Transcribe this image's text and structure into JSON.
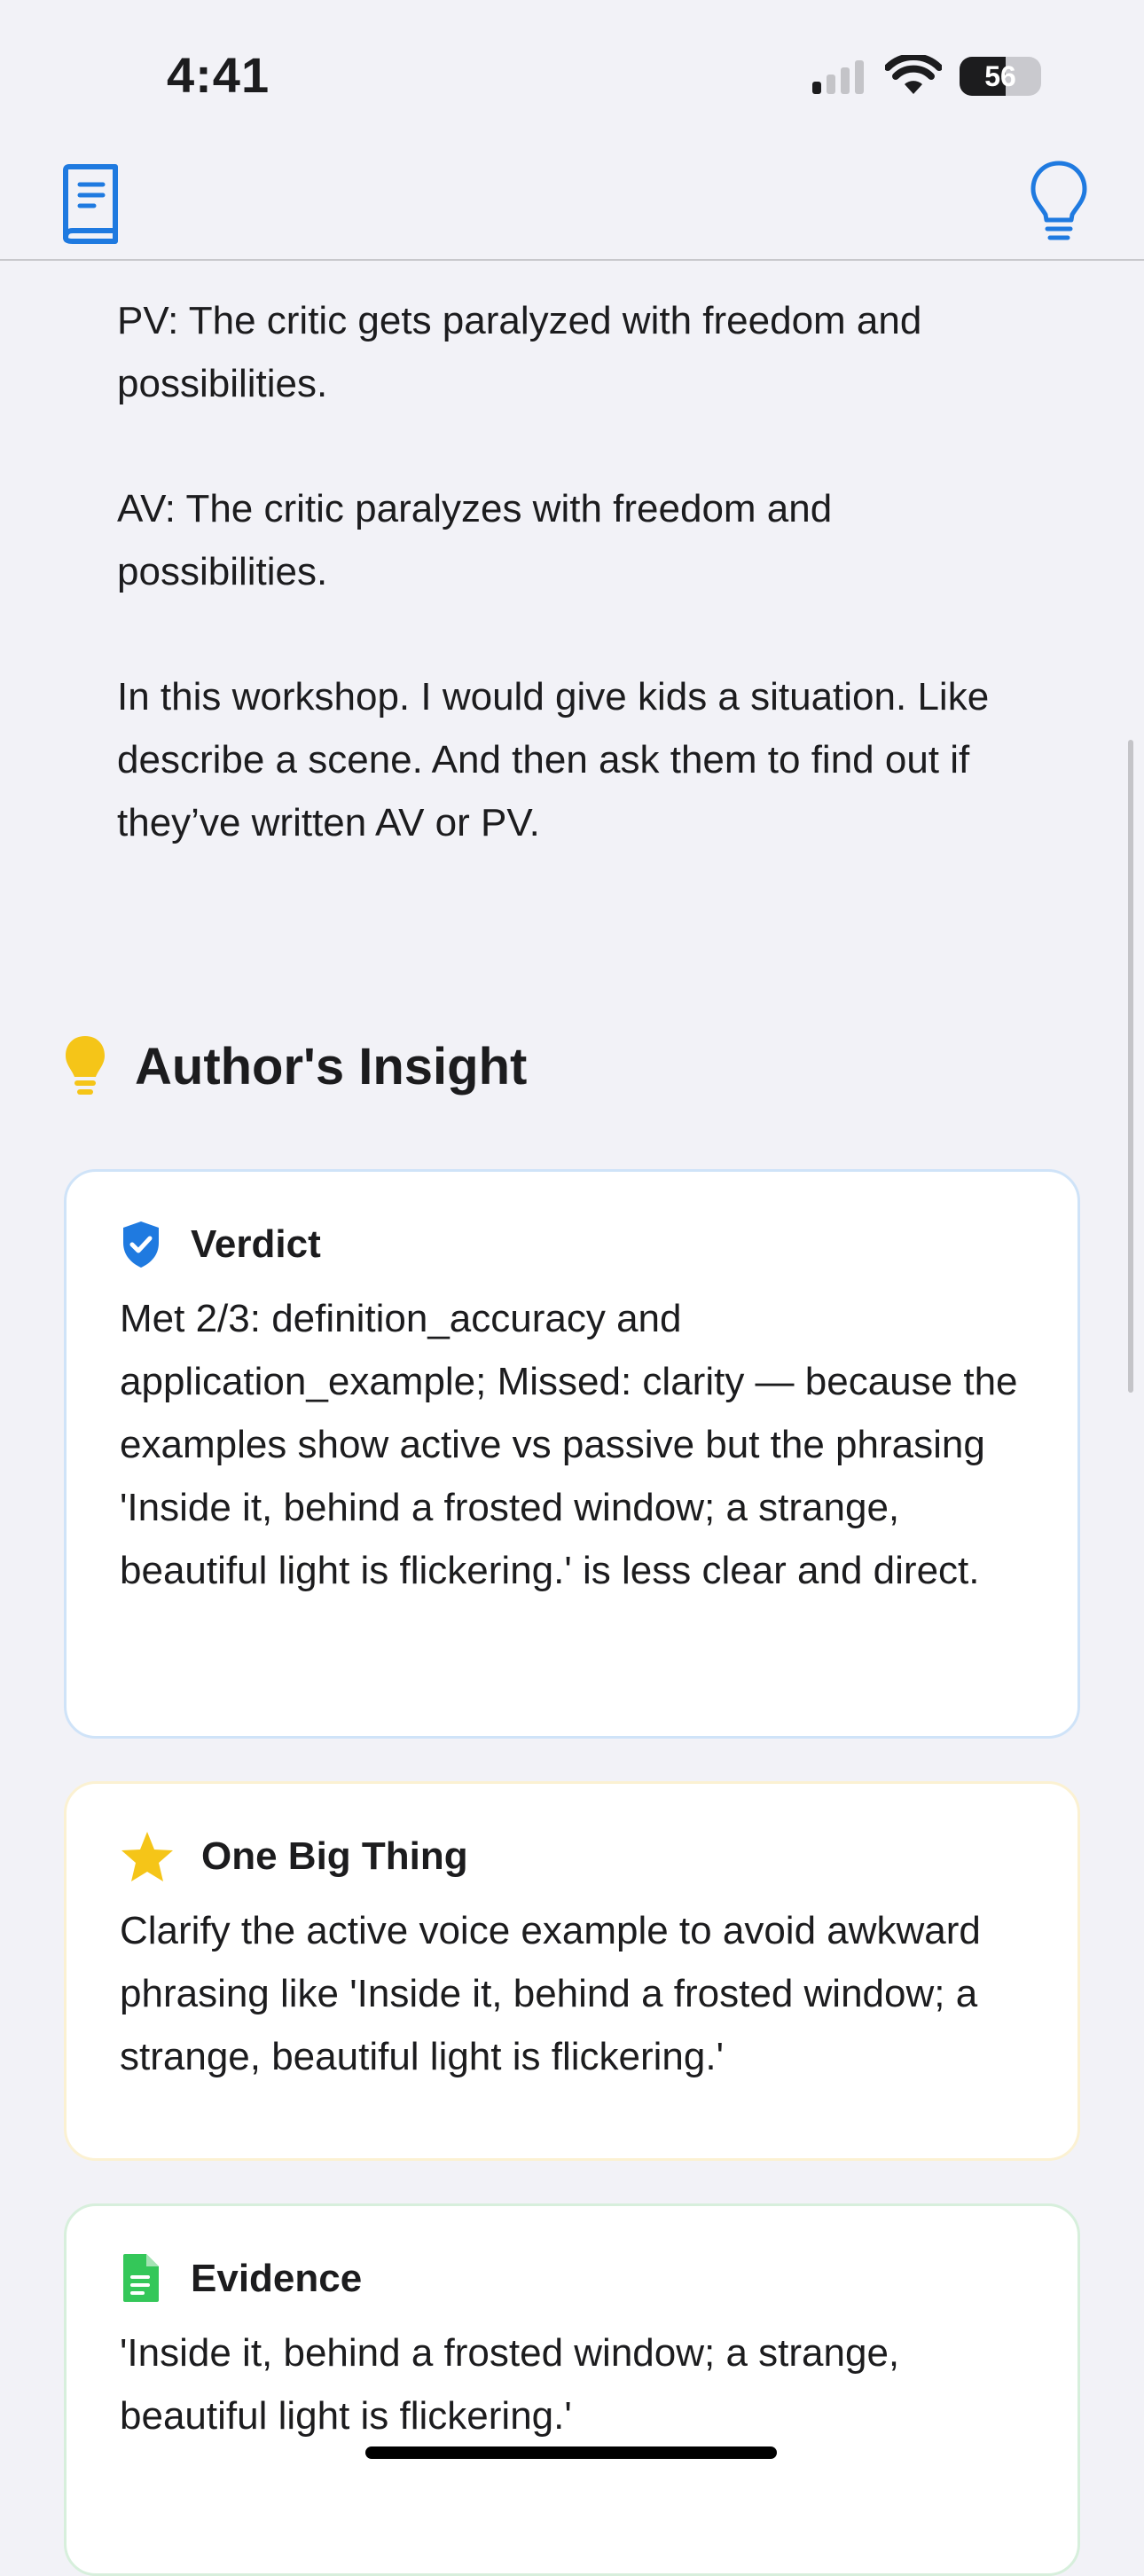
{
  "status_bar": {
    "time": "4:41",
    "battery_level": "56",
    "battery_fraction": 0.56
  },
  "nav": {
    "left_icon": "book-icon",
    "right_icon": "lightbulb-icon",
    "accent_color": "#1f7ae0"
  },
  "content": {
    "paragraphs": [
      "PV: The critic gets paralyzed with freedom and possibilities.",
      "AV: The critic paralyzes with freedom and possibilities.",
      "In this workshop. I would give kids a situation. Like describe a scene. And then ask them to find out if they’ve written AV or PV."
    ]
  },
  "insight": {
    "title": "Author's Insight",
    "icon": "lightbulb-icon",
    "icon_color": "#f5c518",
    "cards": [
      {
        "title": "Verdict",
        "icon": "shield-check-icon",
        "icon_color": "#1f7ae0",
        "body": "Met 2/3: definition_accuracy and application_example; Missed: clarity — because the examples show active vs passive but the phrasing 'Inside it, behind a frosted window; a strange, beautiful light is flickering.' is less clear and direct."
      },
      {
        "title": "One Big Thing",
        "icon": "star-icon",
        "icon_color": "#f5c518",
        "body": "Clarify the active voice example to avoid awkward phrasing like 'Inside it, behind a frosted window; a strange, beautiful light is flickering.'"
      },
      {
        "title": "Evidence",
        "icon": "document-icon",
        "icon_color": "#34c759",
        "body": "'Inside it, behind a frosted window; a strange, beautiful light is flickering.'"
      }
    ]
  }
}
